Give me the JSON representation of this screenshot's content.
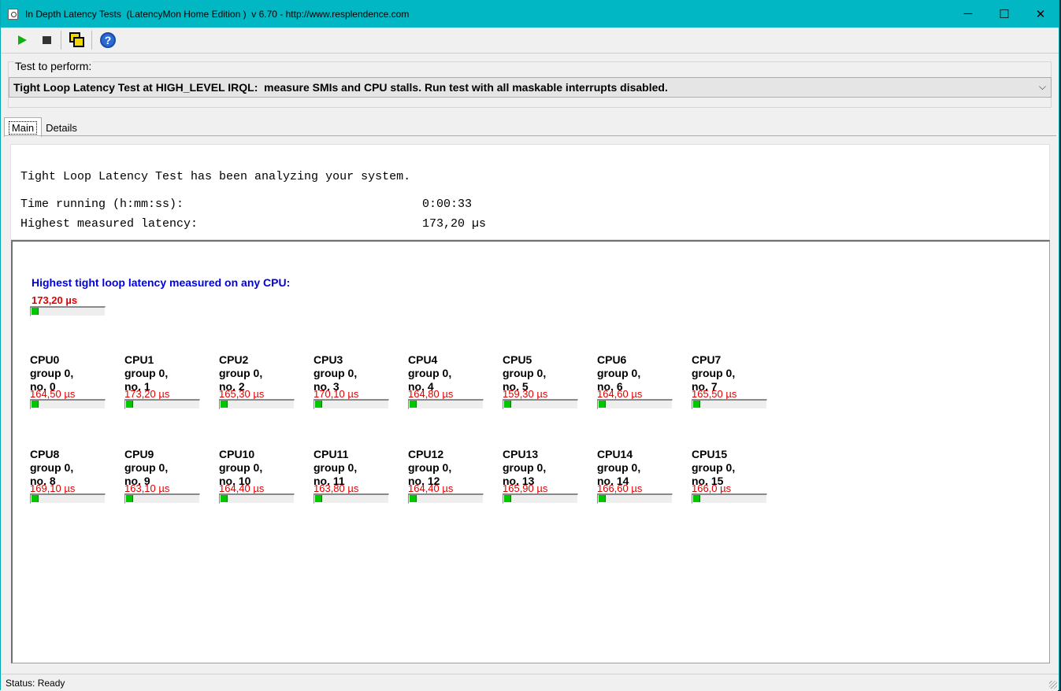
{
  "window": {
    "title": "In Depth Latency Tests  (LatencyMon Home Edition )  v 6.70 - http://www.resplendence.com",
    "minimize_glyph": "─",
    "maximize_glyph": "☐",
    "close_glyph": "✕"
  },
  "toolbar": {
    "icons": [
      "play-icon",
      "stop-icon",
      "windows-icon",
      "help-icon"
    ],
    "help_glyph": "?"
  },
  "test": {
    "label": "Test to perform:",
    "selected": "Tight Loop Latency Test at HIGH_LEVEL IRQL:  measure SMIs and CPU stalls. Run test with all maskable interrupts disabled.",
    "chevron": "⌵"
  },
  "tabs": [
    {
      "label": "Main"
    },
    {
      "label": "Details"
    }
  ],
  "summary": {
    "headline": "Tight Loop Latency Test has been analyzing your system.",
    "time_label": "Time running (h:mm:ss):",
    "time_value": "0:00:33",
    "latency_label": "Highest measured latency:",
    "latency_value": "173,20 µs"
  },
  "overall": {
    "heading": "Highest tight loop latency measured on any CPU:",
    "value": "173,20 µs",
    "level": 0.08
  },
  "cpus": [
    {
      "name": "CPU0",
      "group": "group 0,",
      "no": "no. 0",
      "value": "164,50 µs",
      "level": 0.08
    },
    {
      "name": "CPU1",
      "group": "group 0,",
      "no": "no. 1",
      "value": "173,20 µs",
      "level": 0.08
    },
    {
      "name": "CPU2",
      "group": "group 0,",
      "no": "no. 2",
      "value": "165,30 µs",
      "level": 0.08
    },
    {
      "name": "CPU3",
      "group": "group 0,",
      "no": "no. 3",
      "value": "170,10 µs",
      "level": 0.08
    },
    {
      "name": "CPU4",
      "group": "group 0,",
      "no": "no. 4",
      "value": "164,80 µs",
      "level": 0.08
    },
    {
      "name": "CPU5",
      "group": "group 0,",
      "no": "no. 5",
      "value": "159,30 µs",
      "level": 0.08
    },
    {
      "name": "CPU6",
      "group": "group 0,",
      "no": "no. 6",
      "value": "164,60 µs",
      "level": 0.08
    },
    {
      "name": "CPU7",
      "group": "group 0,",
      "no": "no. 7",
      "value": "165,50 µs",
      "level": 0.08
    },
    {
      "name": "CPU8",
      "group": "group 0,",
      "no": "no. 8",
      "value": "169,10 µs",
      "level": 0.08
    },
    {
      "name": "CPU9",
      "group": "group 0,",
      "no": "no. 9",
      "value": "163,10 µs",
      "level": 0.08
    },
    {
      "name": "CPU10",
      "group": "group 0,",
      "no": "no. 10",
      "value": "164,40 µs",
      "level": 0.08
    },
    {
      "name": "CPU11",
      "group": "group 0,",
      "no": "no. 11",
      "value": "163,80 µs",
      "level": 0.08
    },
    {
      "name": "CPU12",
      "group": "group 0,",
      "no": "no. 12",
      "value": "164,40 µs",
      "level": 0.08
    },
    {
      "name": "CPU13",
      "group": "group 0,",
      "no": "no. 13",
      "value": "165,90 µs",
      "level": 0.08
    },
    {
      "name": "CPU14",
      "group": "group 0,",
      "no": "no. 14",
      "value": "166,60 µs",
      "level": 0.08
    },
    {
      "name": "CPU15",
      "group": "group 0,",
      "no": "no. 15",
      "value": "166,0 µs",
      "level": 0.08
    }
  ],
  "status": {
    "text": "Status: Ready"
  },
  "colors": {
    "titlebar": "#00b7c3",
    "heading_blue": "#0000e0",
    "value_red": "#e00000",
    "bar_green": "#00c800"
  }
}
